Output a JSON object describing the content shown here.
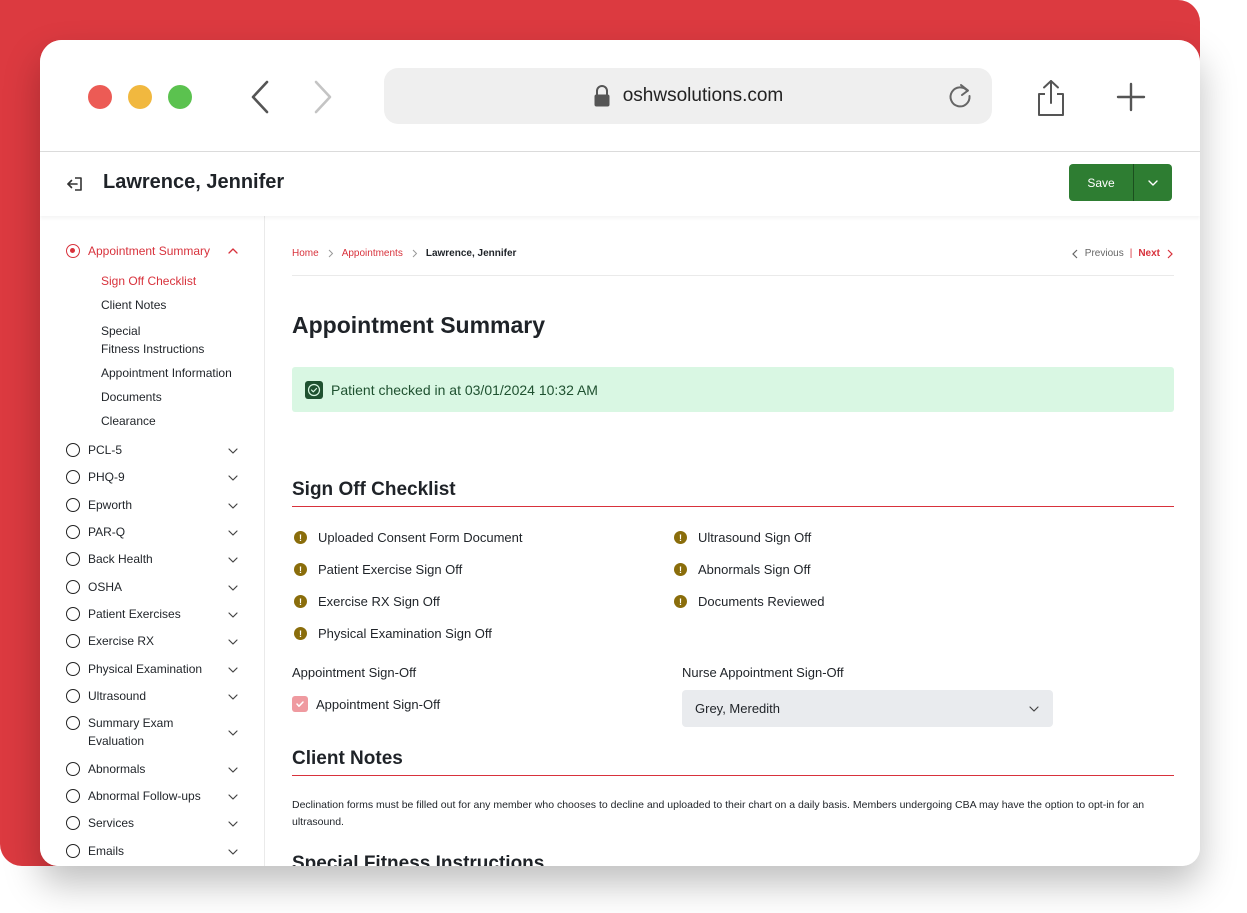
{
  "browser": {
    "url": "oshwsolutions.com"
  },
  "header": {
    "patient_name": "Lawrence, Jennifer",
    "save_label": "Save"
  },
  "sidebar": {
    "active_section": "Appointment Summary",
    "sub_items": [
      {
        "label": "Sign Off Checklist",
        "active": true
      },
      {
        "label": "Client Notes"
      },
      {
        "label": "Special"
      },
      {
        "label": "Fitness Instructions"
      },
      {
        "label": "Appointment Information"
      },
      {
        "label": "Documents"
      },
      {
        "label": "Clearance"
      }
    ],
    "items": [
      {
        "label": "PCL-5"
      },
      {
        "label": "PHQ-9"
      },
      {
        "label": "Epworth"
      },
      {
        "label": "PAR-Q"
      },
      {
        "label": "Back Health"
      },
      {
        "label": "OSHA"
      },
      {
        "label": "Patient Exercises"
      },
      {
        "label": "Exercise RX"
      },
      {
        "label": "Physical Examination"
      },
      {
        "label": "Ultrasound"
      },
      {
        "label": "Summary Exam"
      },
      {
        "label": "Evaluation"
      },
      {
        "label": "Abnormals"
      },
      {
        "label": "Abnormal Follow-ups"
      },
      {
        "label": "Services"
      },
      {
        "label": "Emails"
      }
    ]
  },
  "breadcrumb": {
    "home": "Home",
    "appointments": "Appointments",
    "current": "Lawrence, Jennifer"
  },
  "pager": {
    "previous": "Previous",
    "divider": "|",
    "next": "Next"
  },
  "main": {
    "title": "Appointment Summary",
    "alert": "Patient checked in at 03/01/2024 10:32 AM",
    "sign_off": {
      "title": "Sign Off Checklist",
      "left": [
        "Uploaded Consent Form Document",
        "Patient Exercise Sign Off",
        "Exercise RX Sign Off",
        "Physical Examination Sign Off"
      ],
      "right": [
        "Ultrasound Sign Off",
        "Abnormals Sign Off",
        "Documents Reviewed"
      ],
      "appointment_label": "Appointment Sign-Off",
      "appointment_checkbox_label": "Appointment Sign-Off",
      "nurse_label": "Nurse Appointment Sign-Off",
      "nurse_value": "Grey, Meredith"
    },
    "client_notes": {
      "title": "Client Notes",
      "text": "Declination forms must be filled out for any member who chooses to decline and uploaded to their chart on a daily basis. Members undergoing CBA may have the option to opt-in for an ultrasound."
    },
    "special_fitness": {
      "title": "Special Fitness Instructions"
    }
  },
  "colors": {
    "accent_red": "#d8323c",
    "save_green": "#2e7d32",
    "alert_bg": "#d9f7e3",
    "warning": "#8a6d0b"
  }
}
